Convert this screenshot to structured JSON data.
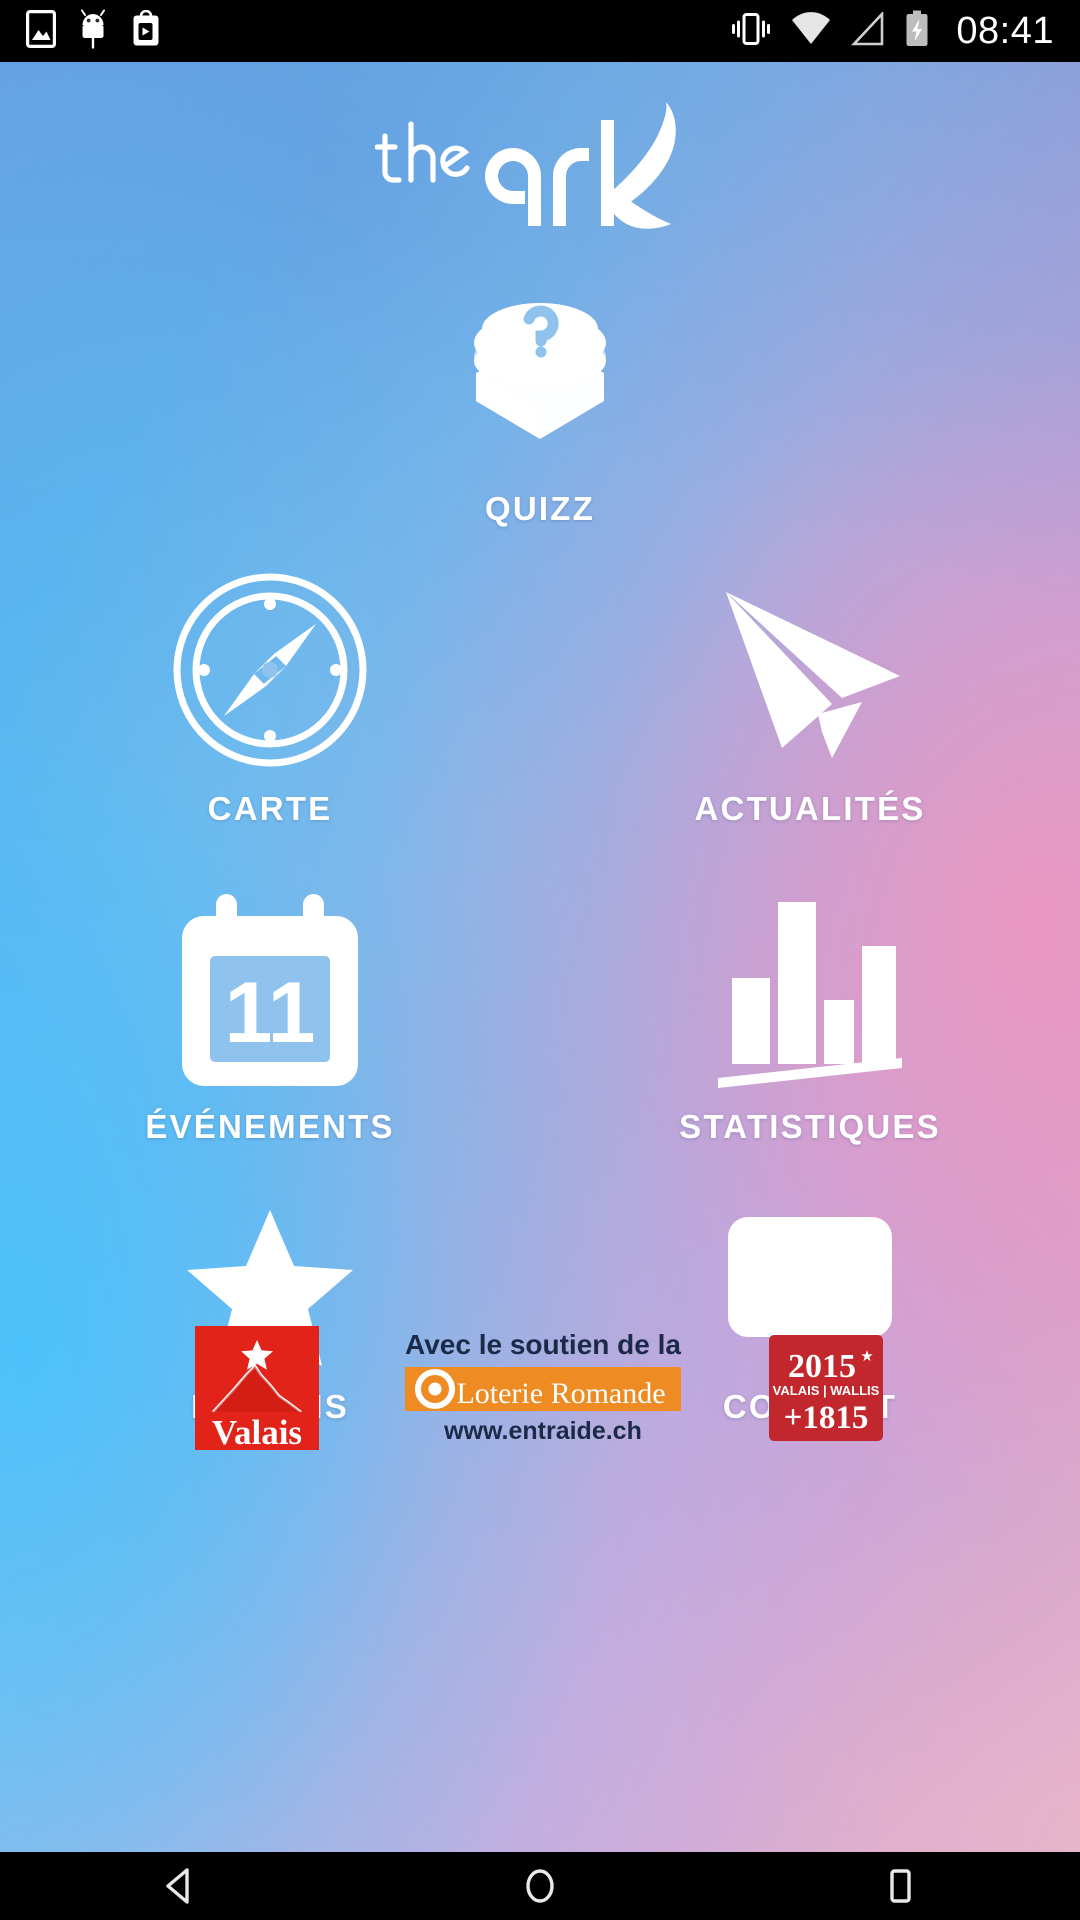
{
  "status_bar": {
    "time": "08:41",
    "left_icons": [
      {
        "name": "screenshot-icon",
        "glyph": "image-in-frame"
      },
      {
        "name": "android-debug-icon",
        "glyph": "android-robot"
      },
      {
        "name": "play-store-update-icon",
        "glyph": "play-bag"
      }
    ],
    "right_icons": [
      {
        "name": "vibrate-mode-icon",
        "glyph": "phone-vibrate"
      },
      {
        "name": "wifi-icon",
        "glyph": "wifi-full"
      },
      {
        "name": "cellular-signal-icon",
        "glyph": "signal-empty"
      },
      {
        "name": "battery-charging-icon",
        "glyph": "battery-bolt"
      }
    ]
  },
  "app": {
    "logo_the": "the",
    "logo_ark": "ark",
    "logo_alt": "the ark"
  },
  "menu": {
    "rows": [
      {
        "tiles": [
          {
            "id": "quizz",
            "label": "QUIZZ",
            "icon": "quizz-button-icon"
          }
        ]
      },
      {
        "tiles": [
          {
            "id": "carte",
            "label": "CARTE",
            "icon": "compass-icon"
          },
          {
            "id": "actualites",
            "label": "ACTUALITÉS",
            "icon": "paper-plane-icon"
          }
        ]
      },
      {
        "tiles": [
          {
            "id": "evenements",
            "label": "ÉVÉNEMENTS",
            "icon": "calendar-icon",
            "calendar_day": "11"
          },
          {
            "id": "statistiques",
            "label": "STATISTIQUES",
            "icon": "bar-chart-icon"
          }
        ]
      },
      {
        "tiles": [
          {
            "id": "favoris",
            "label": "FAVORIS",
            "icon": "star-icon"
          },
          {
            "id": "contact",
            "label": "CONTACT",
            "icon": "speech-bubble-icon"
          }
        ]
      }
    ]
  },
  "sponsors": {
    "valais": {
      "name": "valais-logo",
      "wordmark": "Valais",
      "bg_color": "#E2231A",
      "text_color": "#FFFFFF"
    },
    "loterie": {
      "name": "loterie-romande-logo",
      "support_text": "Avec le soutien de la",
      "wordmark": "Loterie Romande",
      "website": "www.entraide.ch",
      "bar_color": "#EE8B22",
      "text_color": "#1B2A47"
    },
    "anniversary": {
      "name": "valais-wallis-2015-logo",
      "year": "2015",
      "subtitle": "VALAIS | WALLIS",
      "founding": "+1815",
      "bg_color": "#C1272D",
      "text_color": "#FFFFFF"
    }
  },
  "nav_bar": {
    "buttons": [
      {
        "id": "back",
        "icon": "back-triangle-icon"
      },
      {
        "id": "home",
        "icon": "home-circle-icon"
      },
      {
        "id": "recents",
        "icon": "recents-square-icon"
      }
    ]
  },
  "colors": {
    "wallpaper_blue": "#55B9F2",
    "wallpaper_pink": "#EE96BE",
    "icon_white": "#FFFFFF",
    "status_bar_bg": "#000000"
  }
}
